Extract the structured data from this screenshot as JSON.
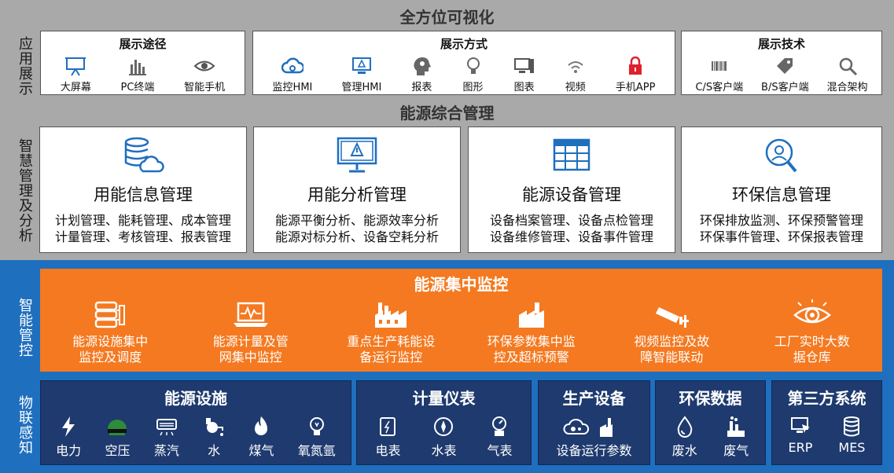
{
  "layers": {
    "app_display": "应用展示",
    "smart_mgmt": "智慧管理及分析",
    "smart_control": "智能管控",
    "iot_sensing": "物联感知"
  },
  "titles": {
    "full_visual": "全方位可视化",
    "energy_mgmt": "能源综合管理"
  },
  "display_path": {
    "title": "展示途径",
    "items": [
      {
        "label": "大屏幕",
        "icon": "presentation-screen-icon"
      },
      {
        "label": "PC终端",
        "icon": "bar-chart-icon"
      },
      {
        "label": "智能手机",
        "icon": "eye-icon"
      }
    ]
  },
  "display_mode": {
    "title": "展示方式",
    "items": [
      {
        "label": "监控HMI",
        "icon": "cloud-icon"
      },
      {
        "label": "管理HMI",
        "icon": "monitor-warning-icon"
      },
      {
        "label": "报表",
        "icon": "head-gear-icon"
      },
      {
        "label": "图形",
        "icon": "lightbulb-icon"
      },
      {
        "label": "图表",
        "icon": "desktop-icon"
      },
      {
        "label": "视频",
        "icon": "wifi-icon"
      },
      {
        "label": "手机APP",
        "icon": "lock-icon"
      }
    ]
  },
  "display_tech": {
    "title": "展示技术",
    "items": [
      {
        "label": "C/S客户端",
        "icon": "barcode-icon"
      },
      {
        "label": "B/S客户端",
        "icon": "tag-icon"
      },
      {
        "label": "混合架构",
        "icon": "search-icon"
      }
    ]
  },
  "mgmt_cards": [
    {
      "title": "用能信息管理",
      "line1": "计划管理、能耗管理、成本管理",
      "line2": "计量管理、考核管理、报表管理",
      "icon": "database-cloud-icon"
    },
    {
      "title": "用能分析管理",
      "line1": "能源平衡分析、能源效率分析",
      "line2": "能源对标分析、设备空耗分析",
      "icon": "monitor-alert-icon"
    },
    {
      "title": "能源设备管理",
      "line1": "设备档案管理、设备点检管理",
      "line2": "设备维修管理、设备事件管理",
      "icon": "table-grid-icon"
    },
    {
      "title": "环保信息管理",
      "line1": "环保排放监测、环保预警管理",
      "line2": "环保事件管理、环保报表管理",
      "icon": "user-search-icon"
    }
  ],
  "monitoring": {
    "title": "能源集中监控",
    "items": [
      {
        "line1": "能源设施集中",
        "line2": "监控及调度",
        "icon": "server-icon"
      },
      {
        "line1": "能源计量及管",
        "line2": "网集中监控",
        "icon": "laptop-pulse-icon"
      },
      {
        "line1": "重点生产耗能设",
        "line2": "备运行监控",
        "icon": "factory-icon"
      },
      {
        "line1": "环保参数集中监",
        "line2": "控及超标预警",
        "icon": "plant-icon"
      },
      {
        "line1": "视频监控及故",
        "line2": "障智能联动",
        "icon": "cctv-camera-icon"
      },
      {
        "line1": "工厂实时大数",
        "line2": "据仓库",
        "icon": "eye-scan-icon"
      }
    ]
  },
  "sensing": {
    "energy_facilities": {
      "title": "能源设施",
      "items": [
        {
          "label": "电力",
          "icon": "lightning-icon"
        },
        {
          "label": "空压",
          "icon": "dome-icon"
        },
        {
          "label": "蒸汽",
          "icon": "air-conditioner-icon"
        },
        {
          "label": "水",
          "icon": "water-pump-icon"
        },
        {
          "label": "煤气",
          "icon": "flame-icon"
        },
        {
          "label": "氧氮氩",
          "icon": "bulb-icon"
        }
      ]
    },
    "meters": {
      "title": "计量仪表",
      "items": [
        {
          "label": "电表",
          "icon": "electric-meter-icon"
        },
        {
          "label": "水表",
          "icon": "compass-gauge-icon"
        },
        {
          "label": "气表",
          "icon": "gas-meter-icon"
        }
      ]
    },
    "production": {
      "title": "生产设备",
      "items": [
        {
          "label": "设备运行参数",
          "icon": "cloud-gear-factory-icon"
        }
      ]
    },
    "env_data": {
      "title": "环保数据",
      "items": [
        {
          "label": "废水",
          "icon": "water-drop-icon"
        },
        {
          "label": "废气",
          "icon": "chimney-icon"
        }
      ]
    },
    "third_party": {
      "title": "第三方系统",
      "items": [
        {
          "label": "ERP",
          "icon": "monitor-cursor-icon"
        },
        {
          "label": "MES",
          "icon": "database-icon"
        }
      ]
    }
  },
  "colors": {
    "gray_band": "#a9a9a9",
    "blue_band": "#1f6fbf",
    "orange": "#f47920",
    "navy": "#1e3a6e",
    "icon_blue": "#1f6fbf"
  }
}
